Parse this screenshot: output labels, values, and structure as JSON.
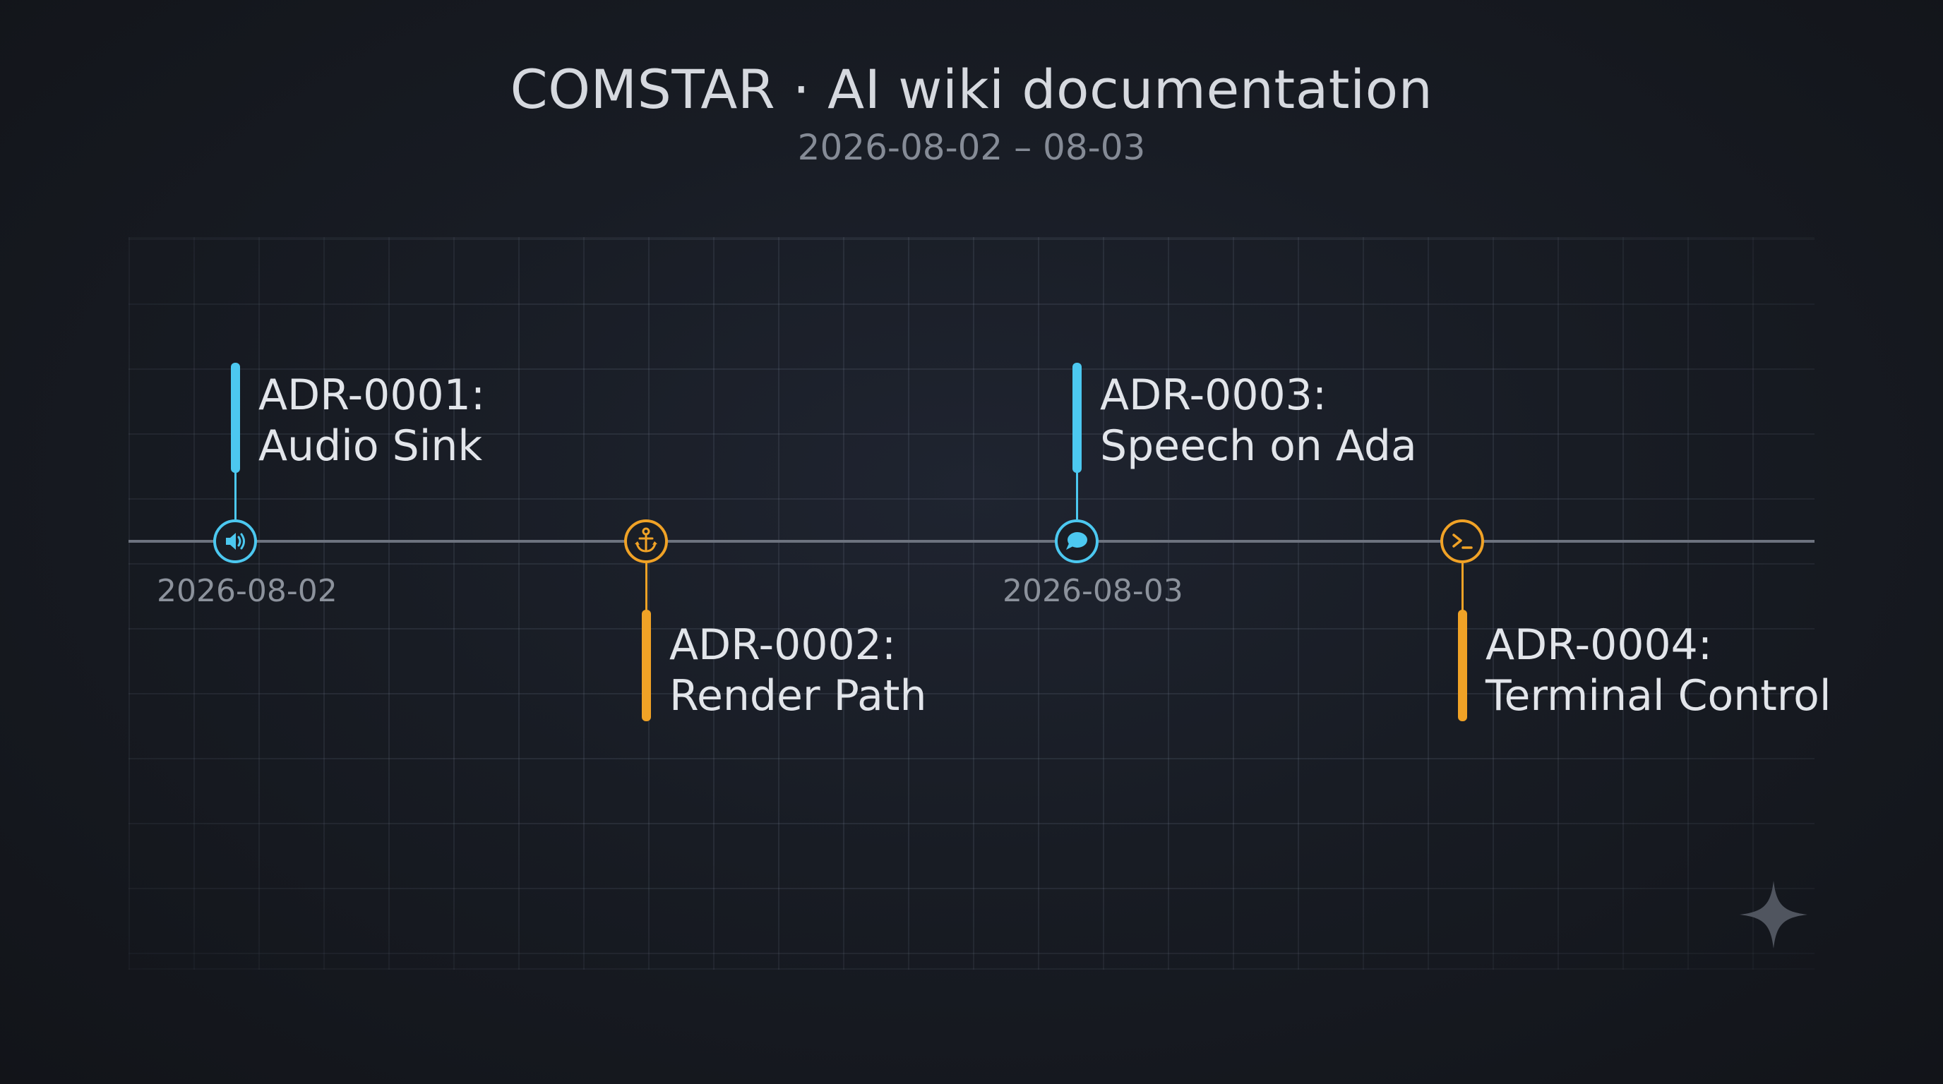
{
  "header": {
    "title": "COMSTAR · AI wiki documentation",
    "subtitle": "2026-08-02 – 08-03"
  },
  "timeline": {
    "dates": [
      "2026-08-02",
      "2026-08-03"
    ],
    "events": [
      {
        "id": "ADR-0001:",
        "name": "Audio Sink",
        "icon": "speaker-icon",
        "color": "#4cc8f0",
        "side": "above"
      },
      {
        "id": "ADR-0002:",
        "name": "Render Path",
        "icon": "anchor-icon",
        "color": "#f0a226",
        "side": "below"
      },
      {
        "id": "ADR-0003:",
        "name": "Speech on Ada",
        "icon": "speech-bubble-icon",
        "color": "#4cc8f0",
        "side": "above"
      },
      {
        "id": "ADR-0004:",
        "name": "Terminal Control",
        "icon": "terminal-icon",
        "color": "#f0a226",
        "side": "below"
      }
    ]
  },
  "colors": {
    "background": "#14171d",
    "axis": "#6d737f",
    "accent_primary": "#4cc8f0",
    "accent_secondary": "#f0a226"
  }
}
